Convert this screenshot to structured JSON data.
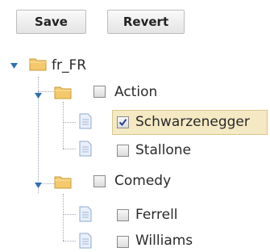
{
  "toolbar": {
    "save_label": "Save",
    "revert_label": "Revert"
  },
  "tree": {
    "root": {
      "label": "fr_FR",
      "expanded": true,
      "children": [
        {
          "label": "Action",
          "expanded": true,
          "checked": false,
          "children": [
            {
              "label": "Schwarzenegger",
              "checked": true,
              "selected": true
            },
            {
              "label": "Stallone",
              "checked": false,
              "selected": false
            }
          ]
        },
        {
          "label": "Comedy",
          "expanded": true,
          "checked": false,
          "children": [
            {
              "label": "Ferrell",
              "checked": false,
              "selected": false
            },
            {
              "label": "Williams",
              "checked": false,
              "selected": false
            }
          ]
        }
      ]
    }
  },
  "colors": {
    "selection_bg": "#f5e9c4",
    "folder": "#f3c96b",
    "expander": "#2f6fb0"
  },
  "icons": {
    "expander": "collapse-triangle-icon",
    "folder": "folder-icon",
    "document": "document-icon",
    "checkbox": "checkbox-icon"
  }
}
